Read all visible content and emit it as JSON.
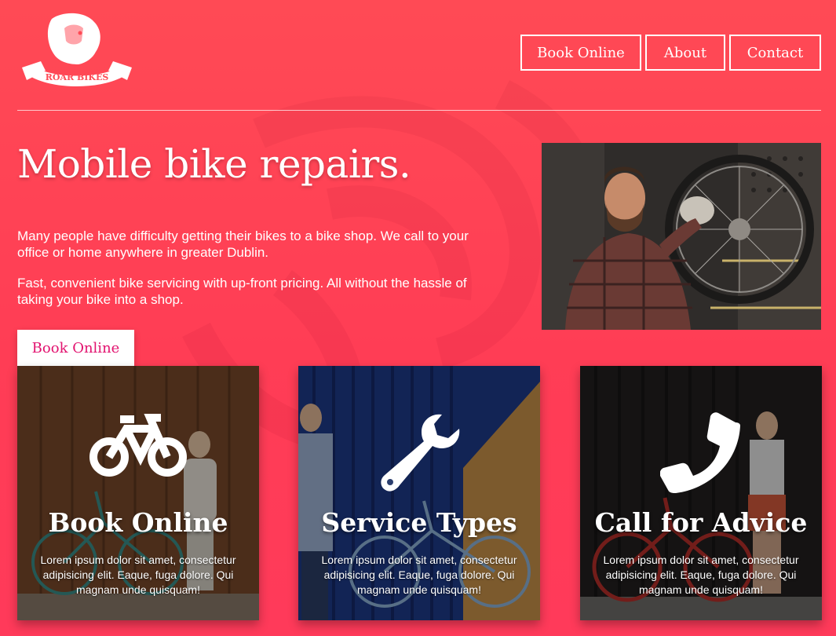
{
  "brand": {
    "logo_text": "ROAR BIKES"
  },
  "nav": {
    "items": [
      "Book Online",
      "About",
      "Contact"
    ]
  },
  "hero": {
    "title": "Mobile bike repairs.",
    "paragraph1": "Many people have difficulty getting their bikes to a bike shop. We call to your office or home anywhere in greater Dublin.",
    "paragraph2": "Fast, convenient bike servicing with up-front pricing. All without the hassle of taking your bike into a shop.",
    "cta_label": "Book Online"
  },
  "cards": [
    {
      "title": "Book Online",
      "text": "Lorem ipsum dolor sit amet, consectetur adipisicing elit. Eaque, fuga dolore. Qui magnam unde quisquam!",
      "icon": "bicycle-icon"
    },
    {
      "title": "Service Types",
      "text": "Lorem ipsum dolor sit amet, consectetur adipisicing elit. Eaque, fuga dolore. Qui magnam unde quisquam!",
      "icon": "wrench-icon"
    },
    {
      "title": "Call for Advice",
      "text": "Lorem ipsum dolor sit amet, consectetur adipisicing elit. Eaque, fuga dolore. Qui magnam unde quisquam!",
      "icon": "phone-icon"
    }
  ],
  "colors": {
    "background": "#ff4355",
    "cta_text": "#e2126f",
    "text": "#ffffff"
  }
}
